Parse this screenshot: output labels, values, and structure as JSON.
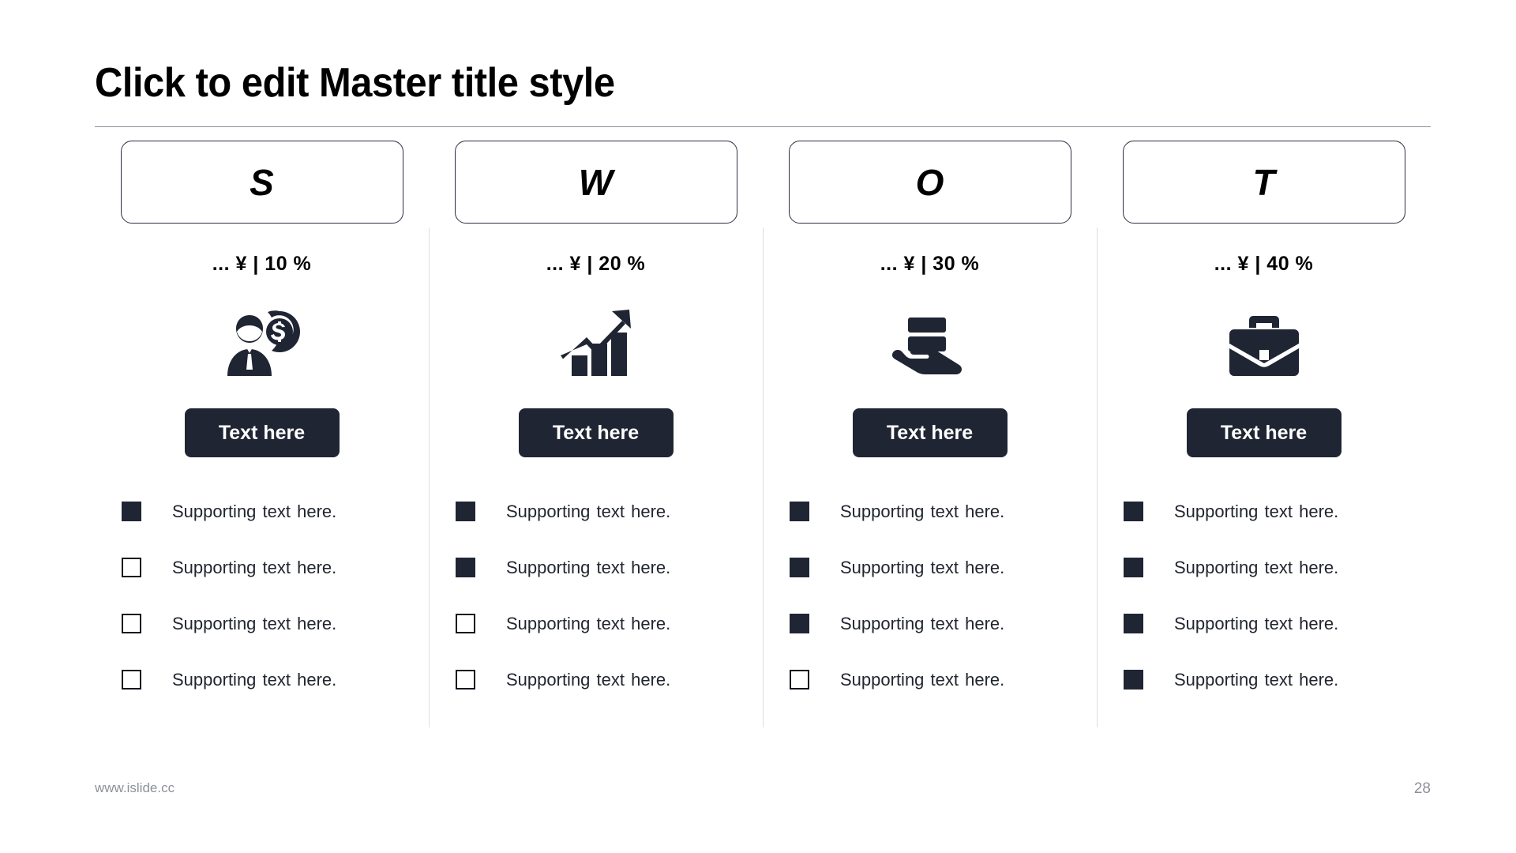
{
  "slide": {
    "title": "Click to edit Master title style",
    "footer_url": "www.islide.cc",
    "page_number": "28",
    "accent_dark": "#1f2533",
    "border_color": "#2b3040",
    "divider_color": "#dcdee2",
    "footer_color": "#8d9199"
  },
  "columns": [
    {
      "letter": "S",
      "metric": "...  ¥  | 10 %",
      "icon": "businessman-dollar-coin-icon",
      "button_label": "Text here",
      "bullets": [
        {
          "text": "Supporting  text here.",
          "filled": true
        },
        {
          "text": "Supporting  text here.",
          "filled": false
        },
        {
          "text": "Supporting  text here.",
          "filled": false
        },
        {
          "text": "Supporting  text here.",
          "filled": false
        }
      ]
    },
    {
      "letter": "W",
      "metric": "...  ¥  | 20 %",
      "icon": "growth-bar-chart-arrow-icon",
      "button_label": "Text here",
      "bullets": [
        {
          "text": "Supporting  text here.",
          "filled": true
        },
        {
          "text": "Supporting  text here.",
          "filled": true
        },
        {
          "text": "Supporting  text here.",
          "filled": false
        },
        {
          "text": "Supporting  text here.",
          "filled": false
        }
      ]
    },
    {
      "letter": "O",
      "metric": "...  ¥  | 30 %",
      "icon": "hand-holding-cards-icon",
      "button_label": "Text here",
      "bullets": [
        {
          "text": "Supporting  text here.",
          "filled": true
        },
        {
          "text": "Supporting  text here.",
          "filled": true
        },
        {
          "text": "Supporting  text here.",
          "filled": true
        },
        {
          "text": "Supporting  text here.",
          "filled": false
        }
      ]
    },
    {
      "letter": "T",
      "metric": "...  ¥  | 40 %",
      "icon": "briefcase-icon",
      "button_label": "Text here",
      "bullets": [
        {
          "text": "Supporting  text here.",
          "filled": true
        },
        {
          "text": "Supporting  text here.",
          "filled": true
        },
        {
          "text": "Supporting  text here.",
          "filled": true
        },
        {
          "text": "Supporting  text here.",
          "filled": true
        }
      ]
    }
  ]
}
